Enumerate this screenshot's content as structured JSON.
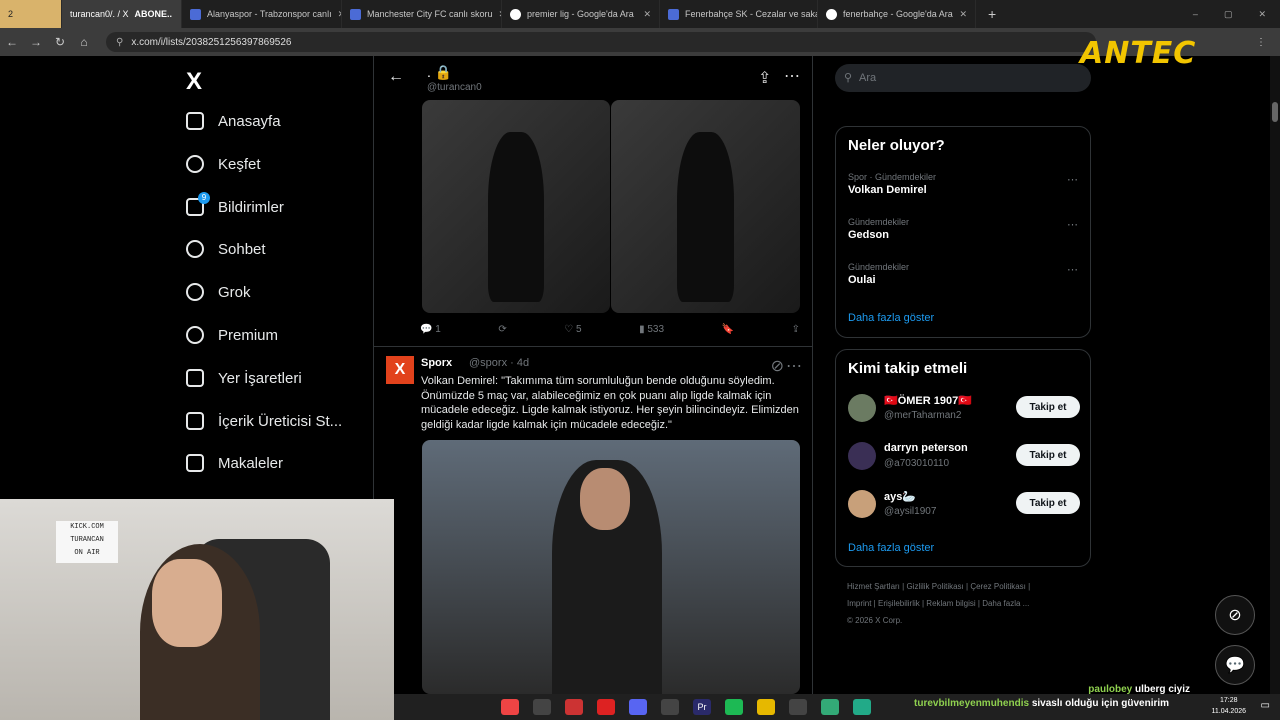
{
  "browser": {
    "tabs": [
      {
        "label": "2",
        "active": false
      },
      {
        "label": "turancan0/. / X",
        "active": true
      },
      {
        "label": "ABONE..",
        "active": false
      },
      {
        "label": "Alanyaspor - Trabzonspor canlı",
        "active": false
      },
      {
        "label": "Manchester City FC canlı skoru",
        "active": false
      },
      {
        "label": "premier lig - Google'da Ara",
        "active": false
      },
      {
        "label": "Fenerbahçe SK - Cezalar ve sakatlıklar",
        "active": false
      },
      {
        "label": "fenerbahçe - Google'da Ara",
        "active": false
      }
    ],
    "url": "x.com/i/lists/2038251256397869526",
    "overlay_logo": "ANTEC"
  },
  "sidebar": {
    "logo": "X",
    "items": [
      {
        "label": "Anasayfa"
      },
      {
        "label": "Keşfet"
      },
      {
        "label": "Bildirimler",
        "badge": "9"
      },
      {
        "label": "Sohbet"
      },
      {
        "label": "Grok"
      },
      {
        "label": "Premium"
      },
      {
        "label": "Yer İşaretleri"
      },
      {
        "label": "İçerik Üreticisi St..."
      },
      {
        "label": "Makaleler"
      }
    ]
  },
  "center": {
    "title": ".",
    "handle": "@turancan0",
    "post1_actions": {
      "replies": "1",
      "reposts": "",
      "likes": "5",
      "views": "533"
    },
    "post2": {
      "name": "Sporx",
      "handle": "@sporx",
      "time": "4d",
      "text": "Volkan Demirel: \"Takımıma tüm sorumluluğun bende olduğunu söyledim. Önümüzde 5 maç var, alabileceğimiz en çok puanı alıp ligde kalmak için mücadele edeceğiz. Ligde kalmak istiyoruz. Her şeyin bilincindeyiz. Elimizden geldiği kadar ligde kalmak için mücadele edeceğiz.\""
    }
  },
  "right": {
    "search_placeholder": "Ara",
    "trends_title": "Neler oluyor?",
    "trends": [
      {
        "category": "Spor · Gündemdekiler",
        "name": "Volkan Demirel"
      },
      {
        "category": "Gündemdekiler",
        "name": "Gedson"
      },
      {
        "category": "Gündemdekiler",
        "name": "Oulai"
      }
    ],
    "show_more": "Daha fazla göster",
    "follow_title": "Kimi takip etmeli",
    "follow": [
      {
        "name": "🇹🇷ÖMER 1907🇹🇷",
        "handle": "@merTaharman2",
        "button": "Takip et"
      },
      {
        "name": "darryn peterson",
        "handle": "@a703010110",
        "button": "Takip et"
      },
      {
        "name": "ays🦢",
        "handle": "@aysil1907",
        "button": "Takip et"
      }
    ],
    "follow_more": "Daha fazla göster",
    "footer_links": [
      "Hizmet Şartları",
      "Gizlilik Politikası",
      "Çerez Politikası",
      "Imprint",
      "Erişilebilirlik",
      "Reklam bilgisi",
      "Daha fazla ..."
    ],
    "copyright": "© 2026 X Corp."
  },
  "webcam": {
    "sign_lines": [
      "KICK.COM",
      "TURANCAN",
      "ON AIR"
    ]
  },
  "stream_chat": [
    {
      "user": "paulobey",
      "text": "ulberg ciyiz"
    },
    {
      "user": "turevbilmeyenmuhendis",
      "text": "sivaslı olduğu için güvenirim"
    }
  ],
  "taskbar": {
    "time": "17:28",
    "date": "11.04.2026"
  }
}
